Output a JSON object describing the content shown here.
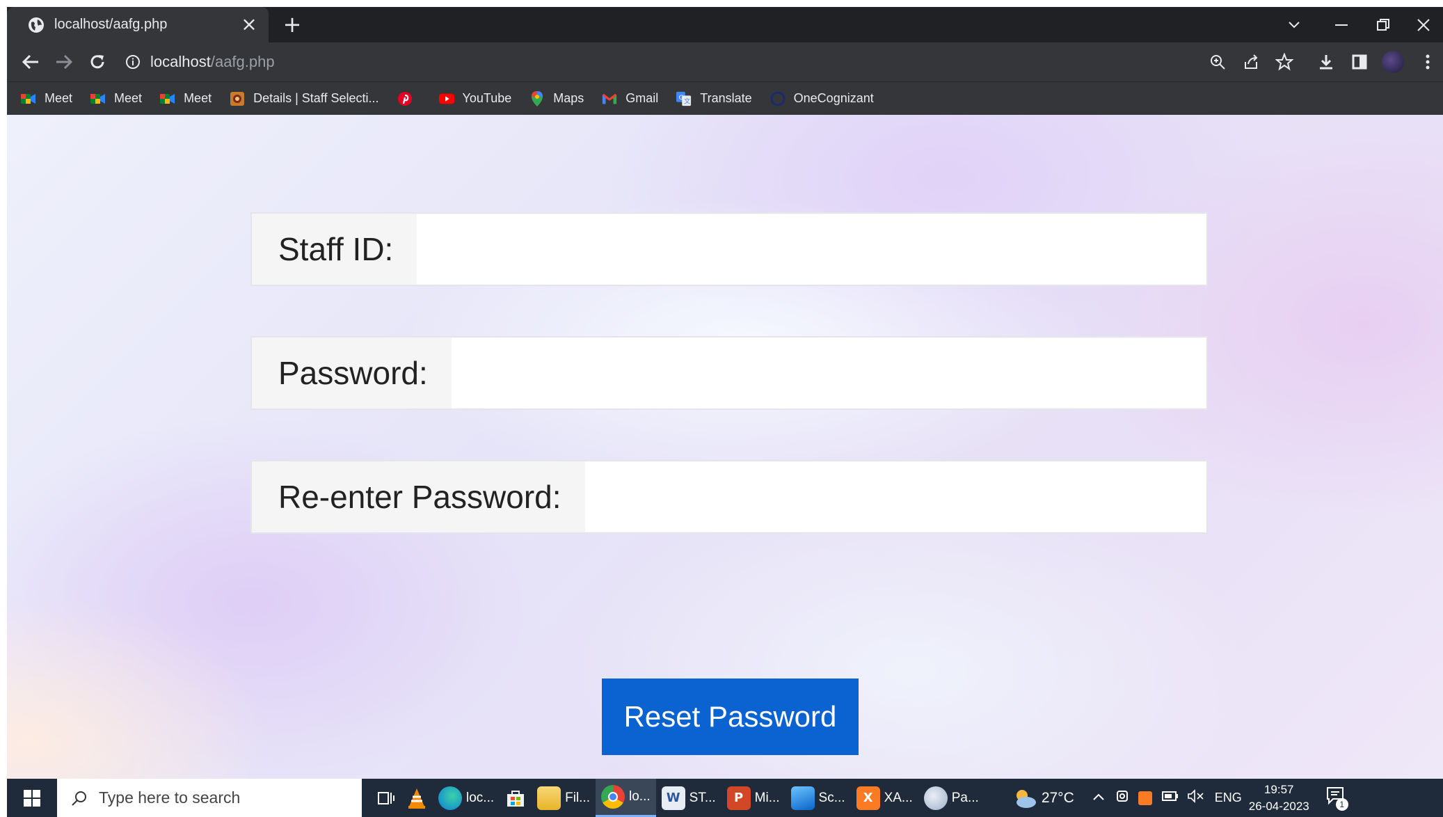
{
  "browser": {
    "tab": {
      "title": "localhost/aafg.php"
    },
    "address": {
      "host": "localhost",
      "path": "/aafg.php"
    },
    "bookmarks": [
      {
        "label": "Meet",
        "icon": "meet-icon"
      },
      {
        "label": "Meet",
        "icon": "meet-icon"
      },
      {
        "label": "Meet",
        "icon": "meet-icon"
      },
      {
        "label": "Details | Staff Selecti...",
        "icon": "ssc-icon"
      },
      {
        "label": "",
        "icon": "pinterest-icon"
      },
      {
        "label": "YouTube",
        "icon": "youtube-icon"
      },
      {
        "label": "Maps",
        "icon": "maps-icon"
      },
      {
        "label": "Gmail",
        "icon": "gmail-icon"
      },
      {
        "label": "Translate",
        "icon": "translate-icon"
      },
      {
        "label": "OneCognizant",
        "icon": "onecognizant-icon"
      }
    ]
  },
  "form": {
    "staff_id_label": "Staff ID:",
    "password_label": "Password:",
    "reenter_label": "Re-enter Password:",
    "submit_label": "Reset Password"
  },
  "taskbar": {
    "search_placeholder": "Type here to search",
    "apps": [
      {
        "label": "loc...",
        "icon": "edge-icon"
      },
      {
        "label": "Fil...",
        "icon": "file-explorer-icon"
      },
      {
        "label": "lo...",
        "icon": "chrome-icon"
      },
      {
        "label": "ST...",
        "icon": "word-icon"
      },
      {
        "label": "Mi...",
        "icon": "powerpoint-icon"
      },
      {
        "label": "Sc...",
        "icon": "photos-icon"
      },
      {
        "label": "XA...",
        "icon": "xampp-icon"
      },
      {
        "label": "Pa...",
        "icon": "paint-icon"
      }
    ],
    "weather": "27°C",
    "language": "ENG",
    "time": "19:57",
    "date": "26-04-2023",
    "notification_count": "1"
  },
  "colors": {
    "button_blue": "#0b63d1",
    "chrome_dark": "#202124",
    "chrome_toolbar": "#35363a",
    "taskbar": "#1f2b3a"
  }
}
